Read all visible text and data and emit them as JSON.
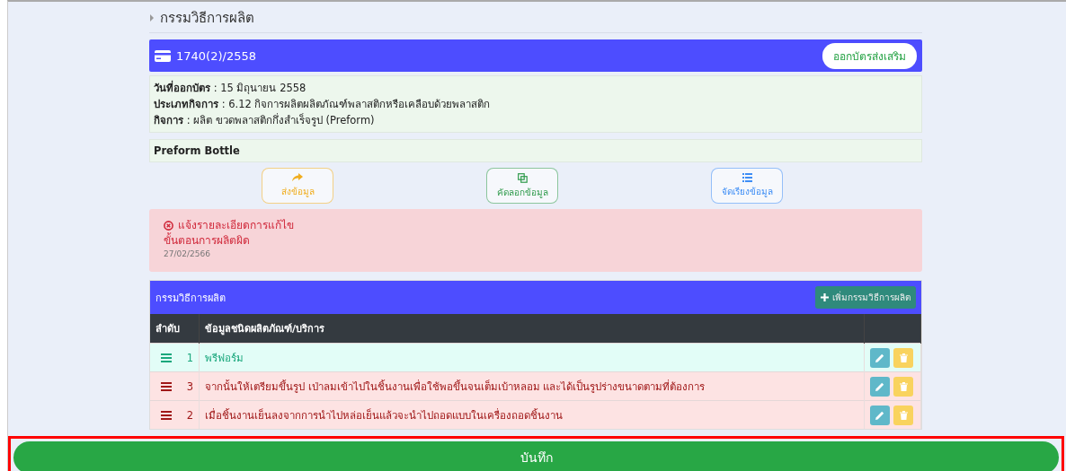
{
  "section_title": "กรรมวิธีการผลิต",
  "card": {
    "number": "1740(2)/2558",
    "action": "ออกบัตรส่งเสริม",
    "details": [
      "**วันที่ออกบัตร** : 15 มิถุนายน 2558",
      "**ประเภทกิจการ** : 6.12 กิจการผลิตผลิตภัณฑ์พลาสติกหรือเคลือบด้วยพลาสติก",
      "**กิจการ** : ผลิต ขวดพลาสติกกึ่งสำเร็จรูป (Preform)"
    ],
    "product": "Preform Bottle"
  },
  "actions": [
    {
      "label": "ส่งข้อมูล",
      "kind": "send"
    },
    {
      "label": "คัดลอกข้อมูล",
      "kind": "copy"
    },
    {
      "label": "จัดเรียงข้อมูล",
      "kind": "sort"
    }
  ],
  "alert": {
    "title": "แจ้งรายละเอียดการแก้ไข",
    "message": "ขั้นตอนการผลิตผิด",
    "date": "27/02/2566"
  },
  "table": {
    "title": "กรรมวิธีการผลิต",
    "add_button": "เพิ่มกรรมวิธีการผลิต",
    "columns": [
      "ลำดับ",
      "ข้อมูลชนิดผลิตภัณฑ์/บริการ"
    ],
    "rows": [
      {
        "order": "1",
        "text": "พรีฟอร์ม",
        "kind": "ok"
      },
      {
        "order": "3",
        "text": "จากนั้นให้เตรียมขึ้นรูป เป่าลมเข้าไปในชิ้นงานเพื่อใช้พอขึ้นจนเต็มเบ้าหลอม และได้เป็นรูปร่างขนาดตามที่ต้องการ",
        "kind": "error"
      },
      {
        "order": "2",
        "text": "เมื่อชิ้นงานเย็นลงจากการนำไปหล่อเย็นแล้วจะนำไปถอดแบบในเครื่องถอดชิ้นงาน",
        "kind": "error"
      }
    ]
  },
  "save_button": {
    "label": "บันทึก",
    "highlighted": true
  }
}
